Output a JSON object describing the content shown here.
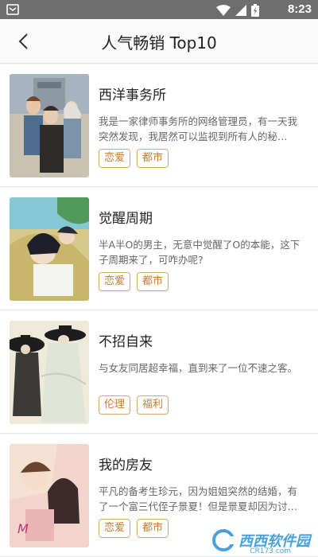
{
  "status_bar": {
    "time": "8:23"
  },
  "header": {
    "title": "人气畅销 Top10"
  },
  "items": [
    {
      "name": "西洋事务所",
      "desc": "我是一家律师事务所的网络管理员，有一天我突然发现，我居然可以监视到所有人的秘…",
      "tags": [
        "恋爱",
        "都市"
      ]
    },
    {
      "name": "觉醒周期",
      "desc": "半A半O的男主，无意中觉醒了O的本能，这下子周期来了，可咋办呢?",
      "tags": [
        "恋爱",
        "都市"
      ]
    },
    {
      "name": "不招自来",
      "desc": "与女友同居超幸福，直到来了一位不速之客。",
      "tags": [
        "伦理",
        "福利"
      ]
    },
    {
      "name": "我的房友",
      "desc": "平凡的备考生珍元，因为姐姐突然的结婚，有了一个富三代侄子景夏！但是景夏却因为讨…",
      "tags": [
        "恋爱",
        "都市"
      ]
    }
  ],
  "watermark": {
    "text": "西西软件园",
    "sub": "CR173.com"
  },
  "icons": [
    "notification-icon",
    "wifi-icon",
    "signal-icon",
    "battery-icon",
    "back-arrow-icon"
  ]
}
